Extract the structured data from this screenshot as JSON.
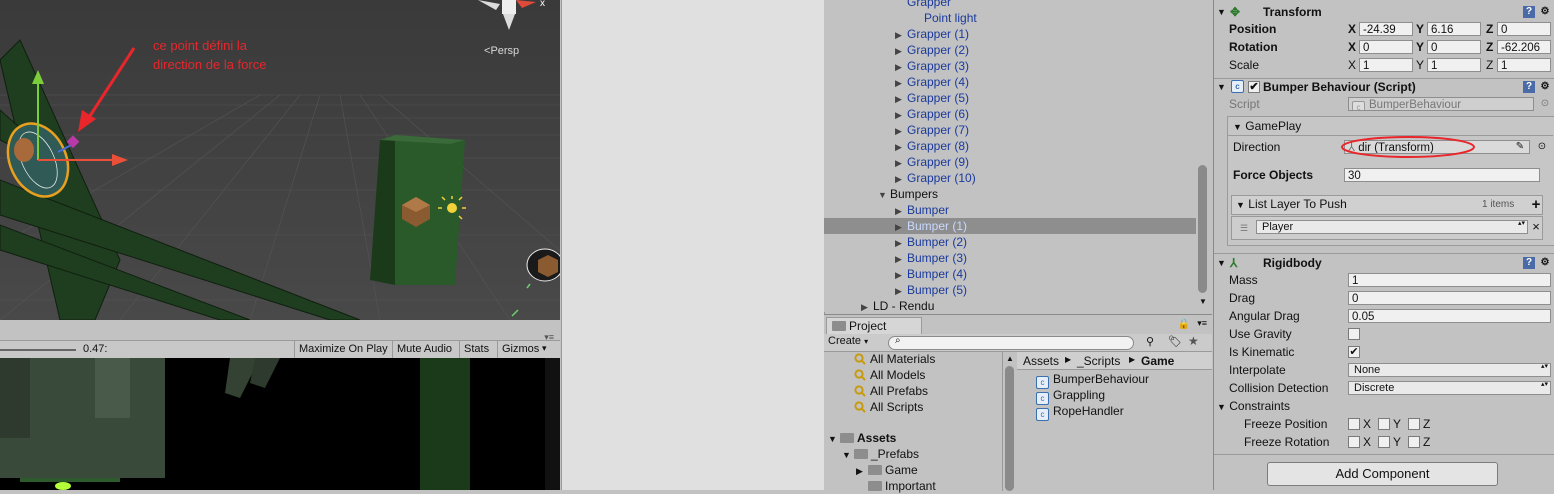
{
  "scene": {
    "annotation_line1": "ce point défini la",
    "annotation_line2": "direction de la force",
    "view_mode": "Persp",
    "gizmo_axis_label": "x"
  },
  "game_toolbar": {
    "scale_value": "0.47:",
    "buttons": [
      "Maximize On Play",
      "Mute Audio",
      "Stats",
      "Gizmos"
    ]
  },
  "hierarchy": {
    "items": [
      {
        "label": "Grapper",
        "indent": 3,
        "arrow": "none",
        "prefab": true
      },
      {
        "label": "Point light",
        "indent": 4,
        "arrow": "none",
        "prefab": true
      },
      {
        "label": "Grapper (1)",
        "indent": 3,
        "arrow": "right",
        "prefab": true
      },
      {
        "label": "Grapper (2)",
        "indent": 3,
        "arrow": "right",
        "prefab": true
      },
      {
        "label": "Grapper (3)",
        "indent": 3,
        "arrow": "right",
        "prefab": true
      },
      {
        "label": "Grapper (4)",
        "indent": 3,
        "arrow": "right",
        "prefab": true
      },
      {
        "label": "Grapper (5)",
        "indent": 3,
        "arrow": "right",
        "prefab": true
      },
      {
        "label": "Grapper (6)",
        "indent": 3,
        "arrow": "right",
        "prefab": true
      },
      {
        "label": "Grapper (7)",
        "indent": 3,
        "arrow": "right",
        "prefab": true
      },
      {
        "label": "Grapper (8)",
        "indent": 3,
        "arrow": "right",
        "prefab": true
      },
      {
        "label": "Grapper (9)",
        "indent": 3,
        "arrow": "right",
        "prefab": true
      },
      {
        "label": "Grapper (10)",
        "indent": 3,
        "arrow": "right",
        "prefab": true
      },
      {
        "label": "Bumpers",
        "indent": 2,
        "arrow": "down",
        "prefab": false
      },
      {
        "label": "Bumper",
        "indent": 3,
        "arrow": "right",
        "prefab": true
      },
      {
        "label": "Bumper (1)",
        "indent": 3,
        "arrow": "right",
        "prefab": true,
        "selected": true
      },
      {
        "label": "Bumper (2)",
        "indent": 3,
        "arrow": "right",
        "prefab": true
      },
      {
        "label": "Bumper (3)",
        "indent": 3,
        "arrow": "right",
        "prefab": true
      },
      {
        "label": "Bumper (4)",
        "indent": 3,
        "arrow": "right",
        "prefab": true
      },
      {
        "label": "Bumper (5)",
        "indent": 3,
        "arrow": "right",
        "prefab": true
      },
      {
        "label": "LD - Rendu",
        "indent": 1,
        "arrow": "right",
        "prefab": false
      }
    ]
  },
  "project": {
    "tab_label": "Project",
    "create_label": "Create",
    "favorites": [
      "All Materials",
      "All Models",
      "All Prefabs",
      "All Scripts"
    ],
    "assets_label": "Assets",
    "folders": [
      {
        "label": "_Prefabs",
        "indent": 1,
        "arrow": "down"
      },
      {
        "label": "Game",
        "indent": 2,
        "arrow": "right"
      },
      {
        "label": "Important",
        "indent": 2,
        "arrow": "none"
      }
    ],
    "breadcrumb": [
      "Assets",
      "_Scripts",
      "Game"
    ],
    "files": [
      "BumperBehaviour",
      "Grappling",
      "RopeHandler"
    ]
  },
  "inspector": {
    "transform": {
      "title": "Transform",
      "position_label": "Position",
      "rotation_label": "Rotation",
      "scale_label": "Scale",
      "position": {
        "x": "-24.39",
        "y": "6.16",
        "z": "0"
      },
      "rotation": {
        "x": "0",
        "y": "0",
        "z": "-62.206"
      },
      "scale": {
        "x": "1",
        "y": "1",
        "z": "1"
      },
      "axis_labels": [
        "X",
        "Y",
        "Z"
      ]
    },
    "bumper": {
      "title": "Bumper Behaviour (Script)",
      "script_label": "Script",
      "script_value": "BumperBehaviour",
      "group_label": "GamePlay",
      "direction_label": "Direction",
      "direction_value": "dir (Transform)",
      "force_label": "Force Objects",
      "force_value": "30",
      "list_label": "List Layer To Push",
      "list_count": "1 items",
      "list_item": "Player"
    },
    "rigidbody": {
      "title": "Rigidbody",
      "mass_label": "Mass",
      "mass": "1",
      "drag_label": "Drag",
      "drag": "0",
      "angular_drag_label": "Angular Drag",
      "angular_drag": "0.05",
      "use_gravity_label": "Use Gravity",
      "use_gravity": false,
      "is_kinematic_label": "Is Kinematic",
      "is_kinematic": true,
      "interpolate_label": "Interpolate",
      "interpolate": "None",
      "collision_label": "Collision Detection",
      "collision": "Discrete",
      "constraints_label": "Constraints",
      "freeze_position_label": "Freeze Position",
      "freeze_rotation_label": "Freeze Rotation",
      "axis_labels": [
        "X",
        "Y",
        "Z"
      ]
    },
    "add_component_label": "Add Component"
  },
  "colors": {
    "prefab_text": "#1a3a9c",
    "annotation": "#e8262b",
    "selection": "#8e8e8e"
  }
}
